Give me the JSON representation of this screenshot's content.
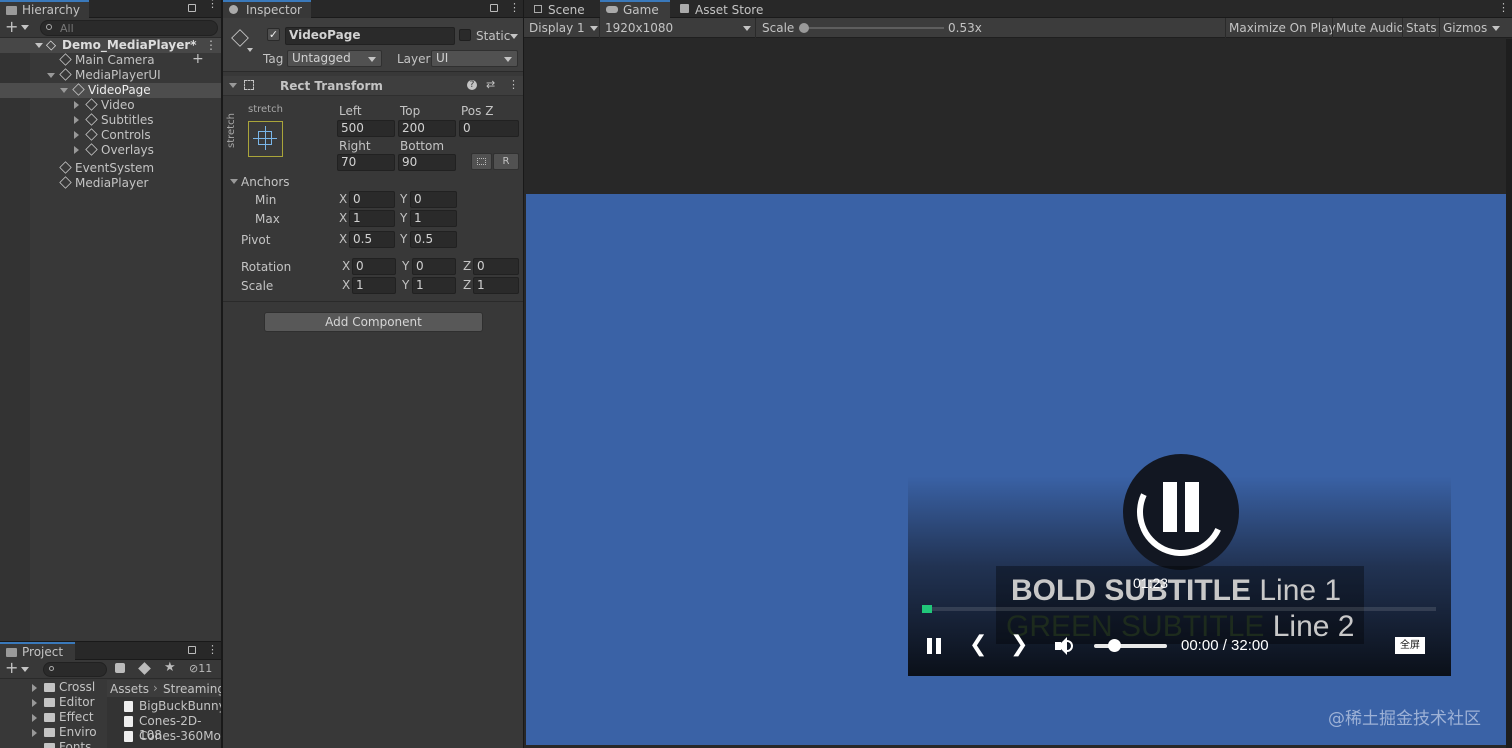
{
  "hierarchy": {
    "tab_label": "Hierarchy",
    "search_placeholder": "All",
    "add_label": "+",
    "tree": [
      {
        "label": "Demo_MediaPlayer*",
        "depth": 0
      },
      {
        "label": "Main Camera",
        "depth": 1
      },
      {
        "label": "MediaPlayerUI",
        "depth": 1
      },
      {
        "label": "VideoPage",
        "depth": 2
      },
      {
        "label": "Video",
        "depth": 3
      },
      {
        "label": "Subtitles",
        "depth": 3
      },
      {
        "label": "Controls",
        "depth": 3
      },
      {
        "label": "Overlays",
        "depth": 3
      },
      {
        "label": "EventSystem",
        "depth": 1
      },
      {
        "label": "MediaPlayer",
        "depth": 1
      }
    ]
  },
  "project": {
    "tab_label": "Project",
    "add_label": "+",
    "hidden_count": "11",
    "folders": [
      "Crossl",
      "Editor",
      "Effect",
      "Enviro",
      "Fonts"
    ],
    "breadcrumb": [
      "Assets",
      "Streaming/"
    ],
    "files": [
      "BigBuckBunny-",
      "Cones-2D-108",
      "Cones-360Mo"
    ]
  },
  "inspector": {
    "tab_label": "Inspector",
    "object_name": "VideoPage",
    "static_label": "Static",
    "tag_label": "Tag",
    "tag_value": "Untagged",
    "layer_label": "Layer",
    "layer_value": "UI",
    "component_title": "Rect Transform",
    "anchor_preset_top": "stretch",
    "anchor_preset_side": "stretch",
    "left_label": "Left",
    "left_value": "500",
    "top_label": "Top",
    "top_value": "200",
    "posz_label": "Pos Z",
    "posz_value": "0",
    "right_label": "Right",
    "right_value": "70",
    "bottom_label": "Bottom",
    "bottom_value": "90",
    "r_button": "R",
    "anchors_label": "Anchors",
    "min_label": "Min",
    "min_x": "0",
    "min_y": "0",
    "max_label": "Max",
    "max_x": "1",
    "max_y": "1",
    "pivot_label": "Pivot",
    "pivot_x": "0.5",
    "pivot_y": "0.5",
    "rotation_label": "Rotation",
    "rot_x": "0",
    "rot_y": "0",
    "rot_z": "0",
    "scale_label": "Scale",
    "scale_x": "1",
    "scale_y": "1",
    "scale_z": "1",
    "x": "X",
    "y": "Y",
    "z": "Z",
    "add_component": "Add Component"
  },
  "game": {
    "tabs": [
      "Scene",
      "Game",
      "Asset Store"
    ],
    "display": "Display 1",
    "resolution": "1920x1080",
    "scale_label": "Scale",
    "scale_value": "0.53x",
    "scale_fraction": 0.0,
    "toolbar_buttons": [
      "Maximize On Play",
      "Mute Audio",
      "Stats",
      "Gizmos"
    ],
    "background_color": "#3a62a6",
    "player": {
      "hover_time": "01:23",
      "subtitle_bold": "BOLD SUBTITLE",
      "subtitle_line1": "Line 1",
      "subtitle_green": "GREEN SUBTITLE",
      "subtitle_line2": "Line 2",
      "time_display": "00:00 / 32:00",
      "fullscreen_label": "全屏",
      "progress_fraction": 0.0,
      "volume_fraction": 0.28
    },
    "watermark": "@稀土掘金技术社区"
  }
}
